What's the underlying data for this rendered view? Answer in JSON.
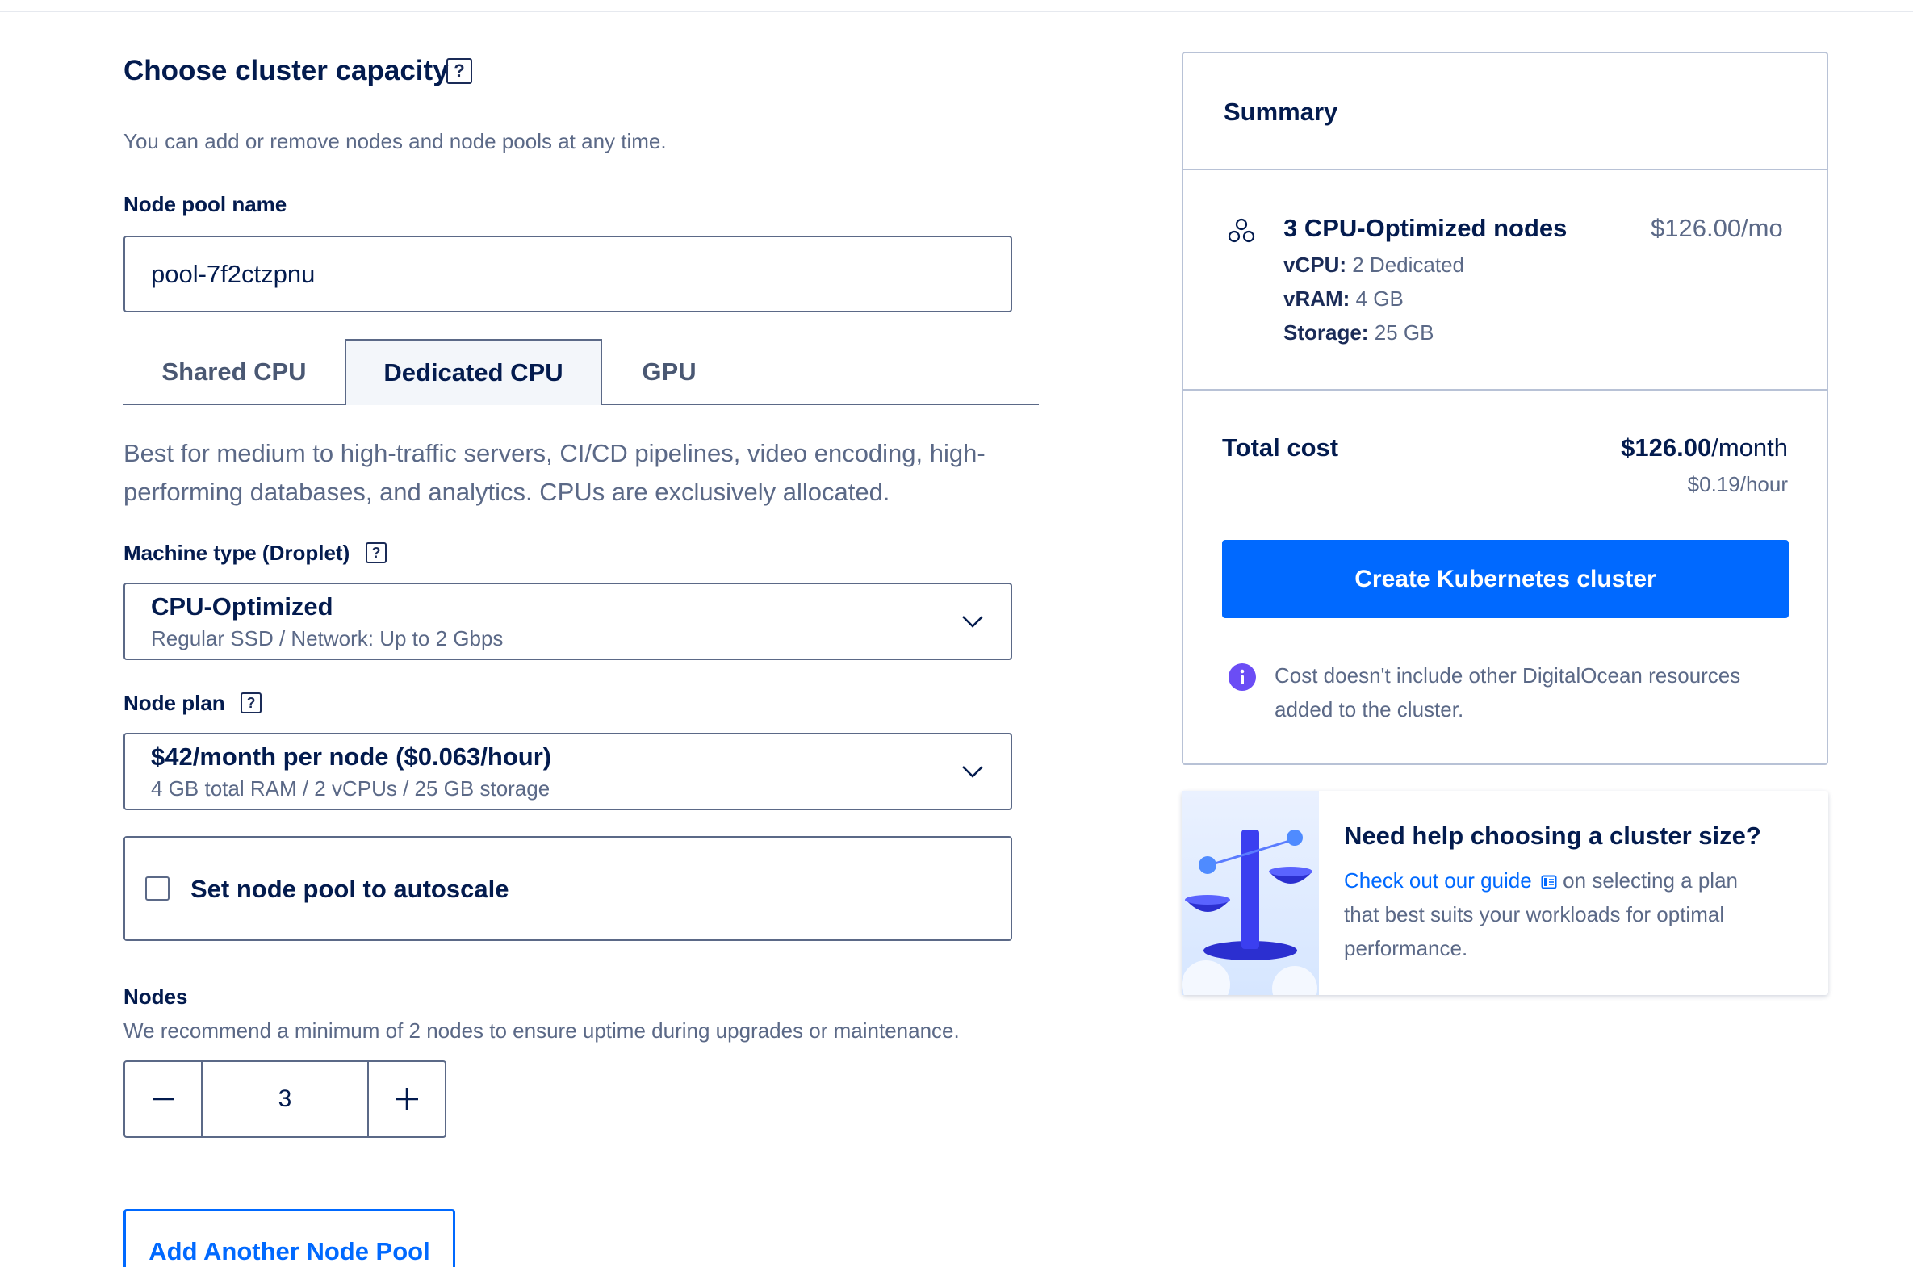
{
  "capacity": {
    "title": "Choose cluster capacity",
    "subtitle": "You can add or remove nodes and node pools at any time."
  },
  "node_pool": {
    "name_label": "Node pool name",
    "name_value": "pool-7f2ctzpnu"
  },
  "tabs": {
    "shared": "Shared CPU",
    "dedicated": "Dedicated CPU",
    "gpu": "GPU",
    "active": "Dedicated CPU"
  },
  "description": {
    "line1": "Best for medium to high-traffic servers, CI/CD pipelines, video encoding, high-",
    "line2": "performing databases, and analytics. CPUs are exclusively allocated."
  },
  "machine_type": {
    "label": "Machine type (Droplet)",
    "title": "CPU-Optimized",
    "subtitle": "Regular SSD / Network: Up to 2 Gbps"
  },
  "node_plan": {
    "label": "Node plan",
    "title": "$42/month per node ($0.063/hour)",
    "subtitle": "4 GB total RAM / 2 vCPUs / 25 GB storage"
  },
  "autoscale": {
    "label": "Set node pool to autoscale",
    "checked": false
  },
  "nodes": {
    "label": "Nodes",
    "hint": "We recommend a minimum of 2 nodes to ensure uptime during upgrades or maintenance.",
    "count": "3",
    "minus": "−",
    "plus": "+"
  },
  "add_pool_button": "Add Another Node Pool",
  "summary": {
    "title": "Summary",
    "item_title": "3 CPU-Optimized nodes",
    "item_price": "$126.00/mo",
    "vcpu_key": "vCPU:",
    "vcpu_val": "2 Dedicated",
    "vram_key": "vRAM:",
    "vram_val": "4 GB",
    "storage_key": "Storage:",
    "storage_val": "25 GB",
    "total_label": "Total cost",
    "total_amount": "$126.00",
    "total_unit": "/month",
    "hourly": "$0.19/hour",
    "create_button": "Create Kubernetes cluster",
    "note_line1": "Cost doesn't include other DigitalOcean resources",
    "note_line2": "added to the cluster."
  },
  "help": {
    "title": "Need help choosing a cluster size?",
    "link_text": "Check out our guide",
    "text_after_link": " on selecting a plan",
    "line2": "that best suits your workloads for optimal",
    "line3": "performance."
  },
  "colors": {
    "primary": "#0069ff",
    "navy": "#031b4e",
    "muted": "#5b6987",
    "info": "#6b4df5"
  },
  "icons": [
    "help-icon",
    "chevron-down-icon",
    "checkbox-icon",
    "minus-icon",
    "plus-icon",
    "nodes-icon",
    "info-icon",
    "external-doc-icon",
    "scale-illustration"
  ]
}
